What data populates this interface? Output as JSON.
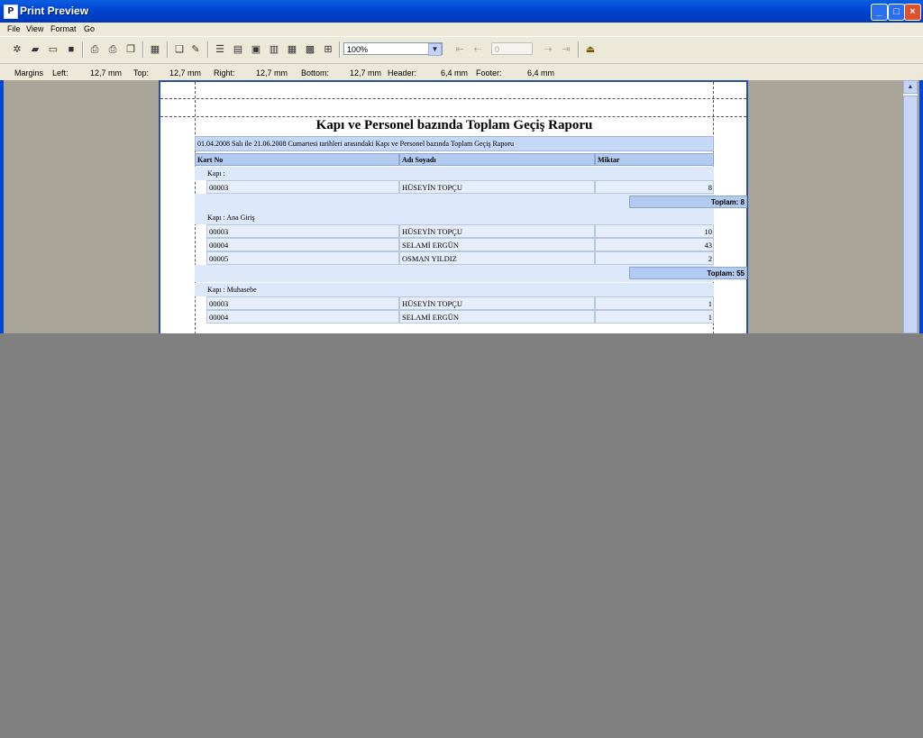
{
  "window": {
    "title": "Print Preview"
  },
  "menu": [
    "File",
    "View",
    "Format",
    "Go"
  ],
  "toolbar": {
    "zoom": "100%",
    "page": "0"
  },
  "margins": {
    "label": "Margins",
    "left_label": "Left:",
    "left": "12,7 mm",
    "top_label": "Top:",
    "top": "12,7 mm",
    "right_label": "Right:",
    "right": "12,7 mm",
    "bottom_label": "Bottom:",
    "bottom": "12,7 mm",
    "header_label": "Header:",
    "header": "6,4 mm",
    "footer_label": "Footer:",
    "footer": "6,4 mm"
  },
  "report": {
    "title": "Kapı ve Personel bazında Toplam Geçiş Raporu",
    "subtitle": "01.04.2008 Salı ile 21.06.2008 Cumartesi tarihleri arasındaki Kapı ve Personel bazında Toplam Geçiş Raporu",
    "columns": [
      "Kart No",
      "Adı Soyadı",
      "Miktar"
    ],
    "groups": [
      {
        "label": "Kapı :",
        "rows": [
          {
            "kart": "00003",
            "ad": "HÜSEYİN TOPÇU",
            "miktar": "8"
          }
        ],
        "total": "Toplam: 8"
      },
      {
        "label": "Kapı : Ana Giriş",
        "rows": [
          {
            "kart": "00003",
            "ad": "HÜSEYİN TOPÇU",
            "miktar": "10"
          },
          {
            "kart": "00004",
            "ad": "SELAMİ ERGÜN",
            "miktar": "43"
          },
          {
            "kart": "00005",
            "ad": "OSMAN YILDIZ",
            "miktar": "2"
          }
        ],
        "total": "Toplam: 55"
      },
      {
        "label": "Kapı : Muhasebe",
        "rows": [
          {
            "kart": "00003",
            "ad": "HÜSEYİN TOPÇU",
            "miktar": "1"
          },
          {
            "kart": "00004",
            "ad": "SELAMİ ERGÜN",
            "miktar": "1"
          }
        ]
      }
    ]
  }
}
